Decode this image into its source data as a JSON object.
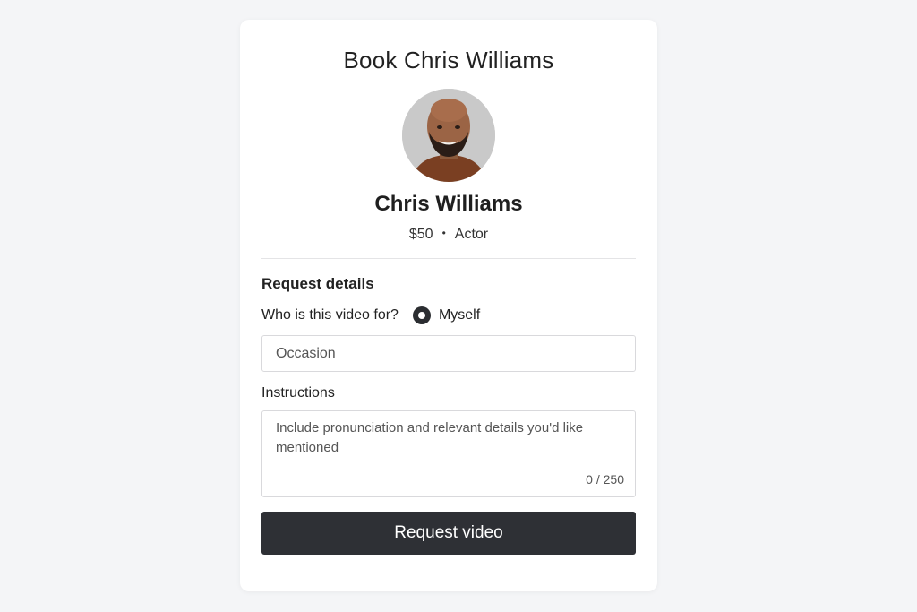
{
  "header": {
    "title": "Book Chris Williams"
  },
  "profile": {
    "name": "Chris Williams",
    "price": "$50",
    "separator": "•",
    "category": "Actor"
  },
  "request": {
    "section_title": "Request details",
    "who_label": "Who is this video for?",
    "recipient_option": "Myself",
    "occasion_placeholder": "Occasion",
    "instructions_label": "Instructions",
    "instructions_placeholder": "Include pronunciation and relevant details you'd like mentioned",
    "char_counter": "0 / 250",
    "submit_label": "Request video"
  },
  "colors": {
    "page_background": "#f4f5f7",
    "card_background": "#ffffff",
    "button_background": "#2e3035",
    "button_text": "#ffffff"
  }
}
